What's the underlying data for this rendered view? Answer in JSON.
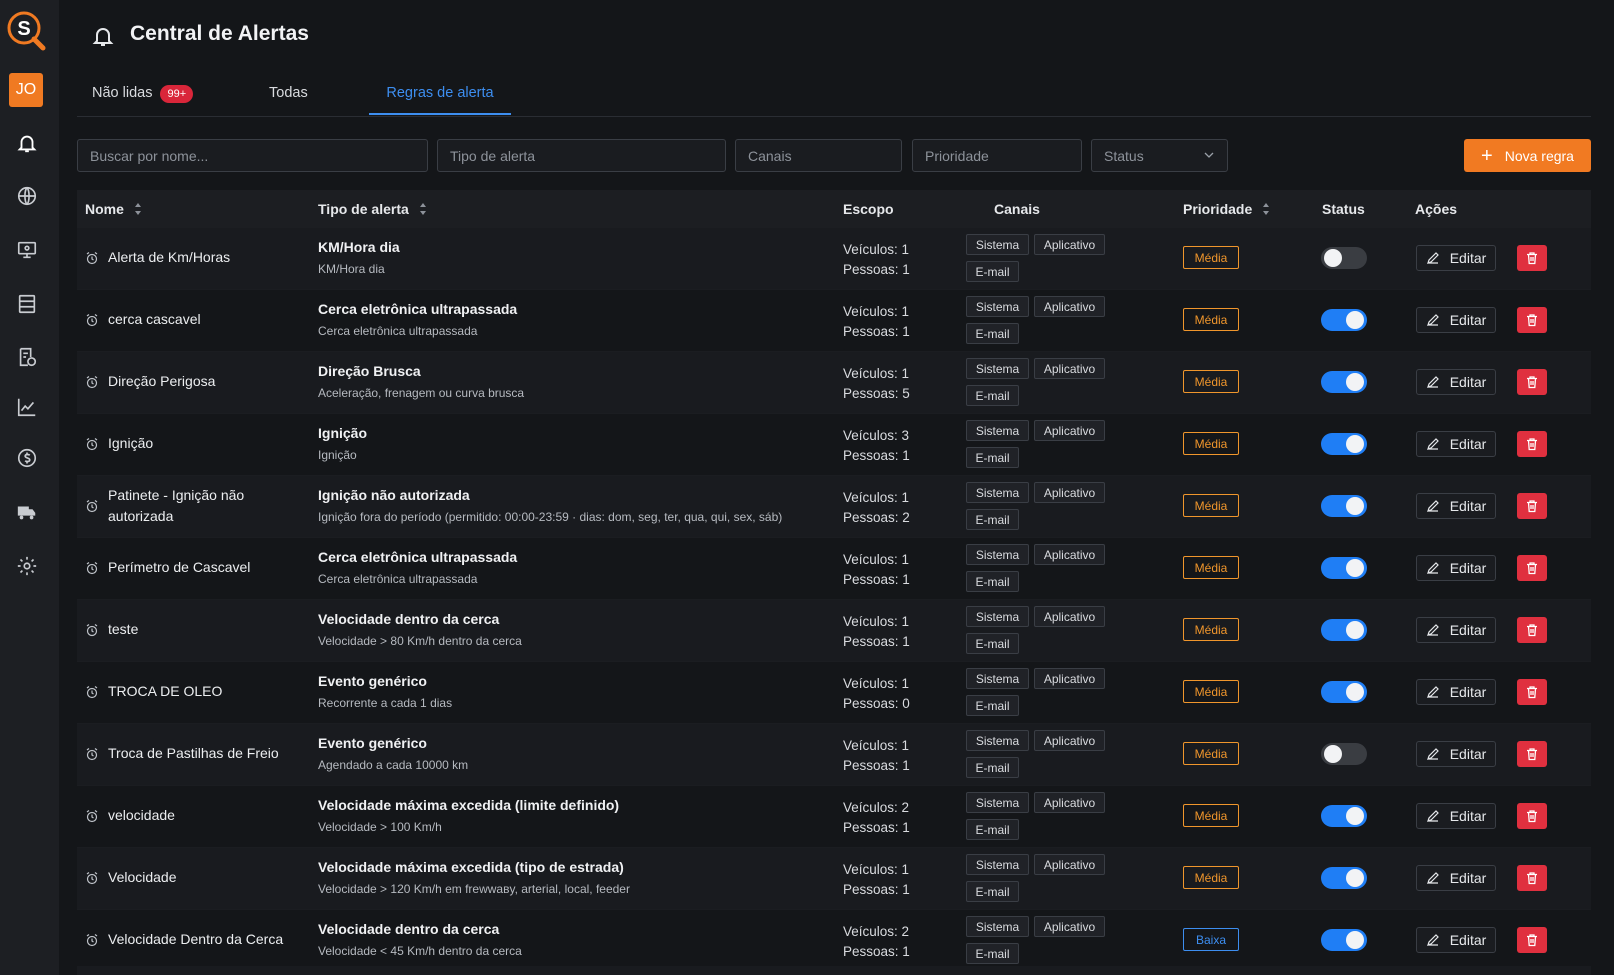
{
  "app": {
    "logo_letter": "S",
    "avatar_initials": "JO"
  },
  "header": {
    "title": "Central de Alertas"
  },
  "tabs": [
    {
      "label": "Não lidas",
      "badge": "99+"
    },
    {
      "label": "Todas"
    },
    {
      "label": "Regras de alerta",
      "active": true
    }
  ],
  "filters": {
    "search_placeholder": "Buscar por nome...",
    "type_placeholder": "Tipo de alerta",
    "channels_placeholder": "Canais",
    "priority_placeholder": "Prioridade",
    "status_placeholder": "Status"
  },
  "new_rule_label": "Nova regra",
  "columns": {
    "name": "Nome",
    "type": "Tipo de alerta",
    "scope": "Escopo",
    "channels": "Canais",
    "priority": "Prioridade",
    "status": "Status",
    "actions": "Ações"
  },
  "channel_labels": {
    "system": "Sistema",
    "app": "Aplicativo",
    "email": "E-mail"
  },
  "edit_label": "Editar",
  "priority_colors": {
    "media": "#f0962c",
    "baixa": "#3d8ef0"
  },
  "rows": [
    {
      "name": "Alerta de Km/Horas",
      "type": "KM/Hora dia",
      "desc": "KM/Hora dia",
      "vehicles": "Veículos: 1",
      "people": "Pessoas: 1",
      "priority": "Média",
      "active": false
    },
    {
      "name": "cerca cascavel",
      "type": "Cerca eletrônica ultrapassada",
      "desc": "Cerca eletrônica ultrapassada",
      "vehicles": "Veículos: 1",
      "people": "Pessoas: 1",
      "priority": "Média",
      "active": true
    },
    {
      "name": "Direção Perigosa",
      "type": "Direção Brusca",
      "desc": "Aceleração, frenagem ou curva brusca",
      "vehicles": "Veículos: 1",
      "people": "Pessoas: 5",
      "priority": "Média",
      "active": true
    },
    {
      "name": "Ignição",
      "type": "Ignição",
      "desc": "Ignição",
      "vehicles": "Veículos: 3",
      "people": "Pessoas: 1",
      "priority": "Média",
      "active": true
    },
    {
      "name": "Patinete - Ignição não autorizada",
      "type": "Ignição não autorizada",
      "desc": "Ignição fora do período (permitido: 00:00-23:59 · dias: dom, seg, ter, qua, qui, sex, sáb)",
      "vehicles": "Veículos: 1",
      "people": "Pessoas: 2",
      "priority": "Média",
      "active": true
    },
    {
      "name": "Perímetro de Cascavel",
      "type": "Cerca eletrônica ultrapassada",
      "desc": "Cerca eletrônica ultrapassada",
      "vehicles": "Veículos: 1",
      "people": "Pessoas: 1",
      "priority": "Média",
      "active": true
    },
    {
      "name": "teste",
      "type": "Velocidade dentro da cerca",
      "desc": "Velocidade > 80 Km/h dentro da cerca",
      "vehicles": "Veículos: 1",
      "people": "Pessoas: 1",
      "priority": "Média",
      "active": true
    },
    {
      "name": "TROCA DE OLEO",
      "type": "Evento genérico",
      "desc": "Recorrente a cada 1 dias",
      "vehicles": "Veículos: 1",
      "people": "Pessoas: 0",
      "priority": "Média",
      "active": true
    },
    {
      "name": "Troca de Pastilhas de Freio",
      "type": "Evento genérico",
      "desc": "Agendado a cada 10000 km",
      "vehicles": "Veículos: 1",
      "people": "Pessoas: 1",
      "priority": "Média",
      "active": false
    },
    {
      "name": "velocidade",
      "type": "Velocidade máxima excedida (limite definido)",
      "desc": "Velocidade > 100 Km/h",
      "vehicles": "Veículos: 2",
      "people": "Pessoas: 1",
      "priority": "Média",
      "active": true
    },
    {
      "name": "Velocidade",
      "type": "Velocidade máxima excedida (tipo de estrada)",
      "desc": "Velocidade > 120 Km/h em frewwaвy, arterial, local, feeder",
      "vehicles": "Veículos: 1",
      "people": "Pessoas: 1",
      "priority": "Média",
      "active": true
    },
    {
      "name": "Velocidade Dentro da Cerca",
      "type": "Velocidade dentro da cerca",
      "desc": "Velocidade < 45 Km/h dentro da cerca",
      "vehicles": "Veículos: 2",
      "people": "Pessoas: 1",
      "priority": "Baixa",
      "active": true
    }
  ]
}
